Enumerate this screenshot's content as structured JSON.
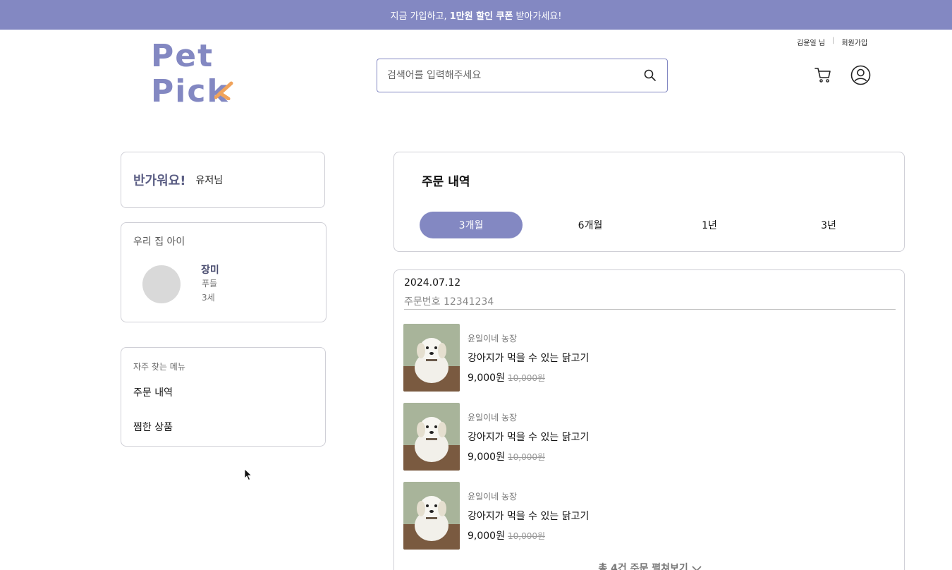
{
  "banner": {
    "pre": "지금 가입하고,",
    "highlight": "1만원 할인 쿠폰",
    "post": "받아가세요!"
  },
  "logo": {
    "line1": "Pet",
    "line2": "Pic",
    "line2_k": "k"
  },
  "search": {
    "placeholder": "검색어를 입력해주세요",
    "icon": "search-icon"
  },
  "top_links": {
    "user": "김윤일 님",
    "signup": "회원가입"
  },
  "header_icons": {
    "cart": "cart-icon",
    "profile": "user-icon"
  },
  "greeting": {
    "hi": "반가워요!",
    "name": "유저님"
  },
  "pet": {
    "title": "우리 집 아이",
    "name": "장미",
    "breed": "푸들",
    "age": "3세"
  },
  "menu": {
    "title": "자주 찾는 메뉴",
    "items": [
      "주문 내역",
      "찜한 상품"
    ]
  },
  "orders": {
    "title": "주문 내역",
    "tabs": [
      "3개월",
      "6개월",
      "1년",
      "3년"
    ],
    "active_tab": "3개월"
  },
  "order": {
    "date": "2024.07.12",
    "number": "주문번호 12341234",
    "items": [
      {
        "seller": "윤일이네 농장",
        "name": "강아지가 먹을 수 있는 닭고기",
        "price": "9,000원",
        "original": "10,000원"
      },
      {
        "seller": "윤일이네 농장",
        "name": "강아지가 먹을 수 있는 닭고기",
        "price": "9,000원",
        "original": "10,000원"
      },
      {
        "seller": "윤일이네 농장",
        "name": "강아지가 먹을 수 있는 닭고기",
        "price": "9,000원",
        "original": "10,000원"
      }
    ],
    "more": "총 4건 주문 펼쳐보기"
  },
  "colors": {
    "accent": "#8388c2",
    "border": "#cfcfd6"
  }
}
